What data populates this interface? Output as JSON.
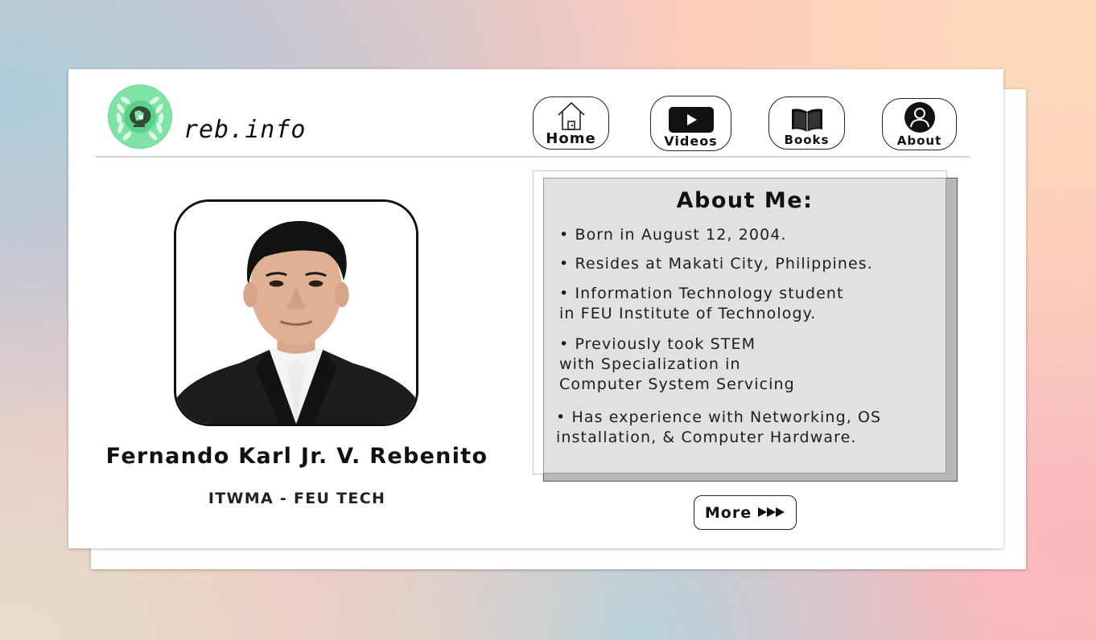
{
  "site": {
    "brand": "reb.info"
  },
  "nav": {
    "home": "Home",
    "videos": "Videos",
    "books": "Books",
    "about": "About"
  },
  "profile": {
    "name": "Fernando Karl Jr. V. Rebenito",
    "org": "ITWMA - FEU TECH"
  },
  "about": {
    "title": "About Me:",
    "items": [
      "• Born in August 12, 2004.",
      "• Resides at Makati City, Philippines.",
      "• Information Technology student\nin FEU Institute of Technology.",
      "• Previously took STEM\nwith Specialization in\nComputer System Servicing",
      "• Has experience with Networking, OS\ninstallation, & Computer Hardware."
    ],
    "more_label": "More"
  },
  "icons": {
    "logo": "laurel-emblem-icon",
    "home": "house-icon",
    "videos": "play-icon",
    "books": "open-book-icon",
    "about": "user-icon",
    "more": "triple-arrow-icon"
  },
  "colors": {
    "logo_green": "#6ddf98",
    "panel_gray": "#e1e1e1",
    "text": "#111111"
  }
}
